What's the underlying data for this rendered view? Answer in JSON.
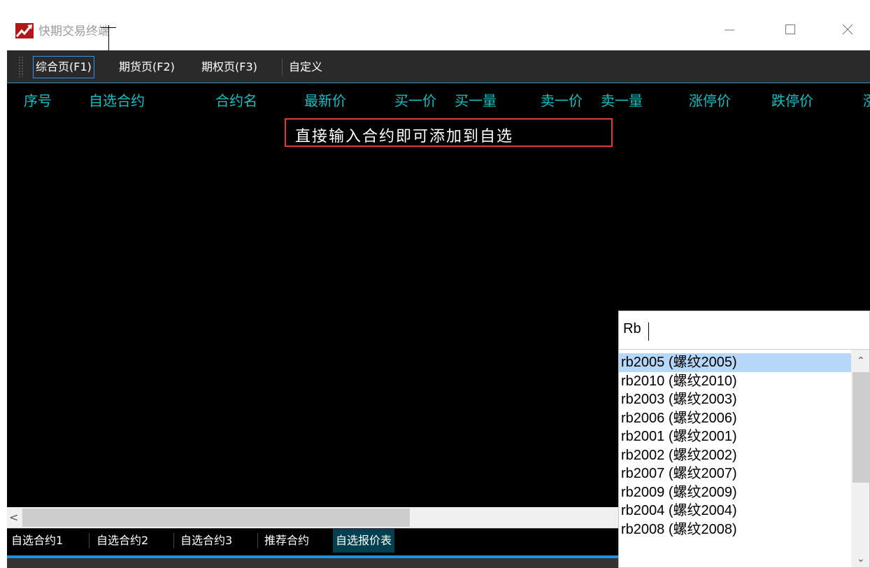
{
  "window": {
    "title": "快期交易终端"
  },
  "menu": {
    "tabs": [
      "综合页(F1)",
      "期货页(F2)",
      "期权页(F3)",
      "自定义"
    ]
  },
  "columns": [
    "序号",
    "自选合约",
    "合约名",
    "最新价",
    "买一价",
    "买一量",
    "卖一价",
    "卖一量",
    "涨停价",
    "跌停价",
    "涨"
  ],
  "hint": "直接输入合约即可添加到自选",
  "bottom_tabs": [
    "自选合约1",
    "自选合约2",
    "自选合约3",
    "推荐合约",
    "自选报价表"
  ],
  "popup": {
    "input_value": "Rb",
    "items": [
      "rb2005 (螺纹2005)",
      "rb2010 (螺纹2010)",
      "rb2003 (螺纹2003)",
      "rb2006 (螺纹2006)",
      "rb2001 (螺纹2001)",
      "rb2002 (螺纹2002)",
      "rb2007 (螺纹2007)",
      "rb2009 (螺纹2009)",
      "rb2004 (螺纹2004)",
      "rb2008 (螺纹2008)"
    ],
    "selected_index": 0
  },
  "colors": {
    "header_text": "#17c0c0",
    "hint_border": "#e23a3a",
    "accent": "#1f8fe0",
    "selection": "#b7d7f8"
  }
}
